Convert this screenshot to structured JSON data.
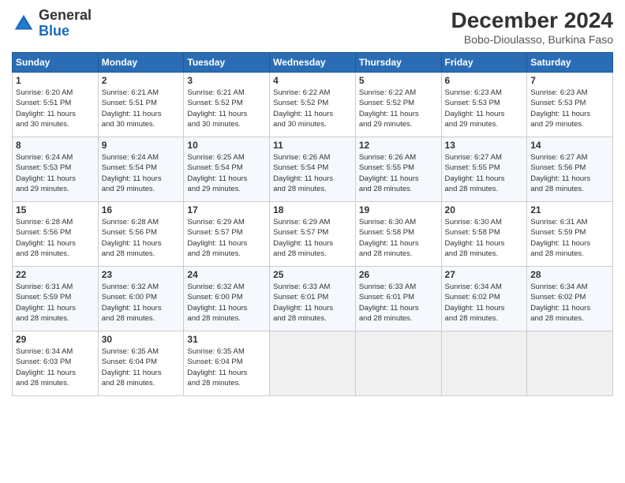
{
  "logo": {
    "line1": "General",
    "line2": "Blue"
  },
  "title": "December 2024",
  "subtitle": "Bobo-Dioulasso, Burkina Faso",
  "days_of_week": [
    "Sunday",
    "Monday",
    "Tuesday",
    "Wednesday",
    "Thursday",
    "Friday",
    "Saturday"
  ],
  "weeks": [
    [
      {
        "day": 1,
        "info": "Sunrise: 6:20 AM\nSunset: 5:51 PM\nDaylight: 11 hours\nand 30 minutes."
      },
      {
        "day": 2,
        "info": "Sunrise: 6:21 AM\nSunset: 5:51 PM\nDaylight: 11 hours\nand 30 minutes."
      },
      {
        "day": 3,
        "info": "Sunrise: 6:21 AM\nSunset: 5:52 PM\nDaylight: 11 hours\nand 30 minutes."
      },
      {
        "day": 4,
        "info": "Sunrise: 6:22 AM\nSunset: 5:52 PM\nDaylight: 11 hours\nand 30 minutes."
      },
      {
        "day": 5,
        "info": "Sunrise: 6:22 AM\nSunset: 5:52 PM\nDaylight: 11 hours\nand 29 minutes."
      },
      {
        "day": 6,
        "info": "Sunrise: 6:23 AM\nSunset: 5:53 PM\nDaylight: 11 hours\nand 29 minutes."
      },
      {
        "day": 7,
        "info": "Sunrise: 6:23 AM\nSunset: 5:53 PM\nDaylight: 11 hours\nand 29 minutes."
      }
    ],
    [
      {
        "day": 8,
        "info": "Sunrise: 6:24 AM\nSunset: 5:53 PM\nDaylight: 11 hours\nand 29 minutes."
      },
      {
        "day": 9,
        "info": "Sunrise: 6:24 AM\nSunset: 5:54 PM\nDaylight: 11 hours\nand 29 minutes."
      },
      {
        "day": 10,
        "info": "Sunrise: 6:25 AM\nSunset: 5:54 PM\nDaylight: 11 hours\nand 29 minutes."
      },
      {
        "day": 11,
        "info": "Sunrise: 6:26 AM\nSunset: 5:54 PM\nDaylight: 11 hours\nand 28 minutes."
      },
      {
        "day": 12,
        "info": "Sunrise: 6:26 AM\nSunset: 5:55 PM\nDaylight: 11 hours\nand 28 minutes."
      },
      {
        "day": 13,
        "info": "Sunrise: 6:27 AM\nSunset: 5:55 PM\nDaylight: 11 hours\nand 28 minutes."
      },
      {
        "day": 14,
        "info": "Sunrise: 6:27 AM\nSunset: 5:56 PM\nDaylight: 11 hours\nand 28 minutes."
      }
    ],
    [
      {
        "day": 15,
        "info": "Sunrise: 6:28 AM\nSunset: 5:56 PM\nDaylight: 11 hours\nand 28 minutes."
      },
      {
        "day": 16,
        "info": "Sunrise: 6:28 AM\nSunset: 5:56 PM\nDaylight: 11 hours\nand 28 minutes."
      },
      {
        "day": 17,
        "info": "Sunrise: 6:29 AM\nSunset: 5:57 PM\nDaylight: 11 hours\nand 28 minutes."
      },
      {
        "day": 18,
        "info": "Sunrise: 6:29 AM\nSunset: 5:57 PM\nDaylight: 11 hours\nand 28 minutes."
      },
      {
        "day": 19,
        "info": "Sunrise: 6:30 AM\nSunset: 5:58 PM\nDaylight: 11 hours\nand 28 minutes."
      },
      {
        "day": 20,
        "info": "Sunrise: 6:30 AM\nSunset: 5:58 PM\nDaylight: 11 hours\nand 28 minutes."
      },
      {
        "day": 21,
        "info": "Sunrise: 6:31 AM\nSunset: 5:59 PM\nDaylight: 11 hours\nand 28 minutes."
      }
    ],
    [
      {
        "day": 22,
        "info": "Sunrise: 6:31 AM\nSunset: 5:59 PM\nDaylight: 11 hours\nand 28 minutes."
      },
      {
        "day": 23,
        "info": "Sunrise: 6:32 AM\nSunset: 6:00 PM\nDaylight: 11 hours\nand 28 minutes."
      },
      {
        "day": 24,
        "info": "Sunrise: 6:32 AM\nSunset: 6:00 PM\nDaylight: 11 hours\nand 28 minutes."
      },
      {
        "day": 25,
        "info": "Sunrise: 6:33 AM\nSunset: 6:01 PM\nDaylight: 11 hours\nand 28 minutes."
      },
      {
        "day": 26,
        "info": "Sunrise: 6:33 AM\nSunset: 6:01 PM\nDaylight: 11 hours\nand 28 minutes."
      },
      {
        "day": 27,
        "info": "Sunrise: 6:34 AM\nSunset: 6:02 PM\nDaylight: 11 hours\nand 28 minutes."
      },
      {
        "day": 28,
        "info": "Sunrise: 6:34 AM\nSunset: 6:02 PM\nDaylight: 11 hours\nand 28 minutes."
      }
    ],
    [
      {
        "day": 29,
        "info": "Sunrise: 6:34 AM\nSunset: 6:03 PM\nDaylight: 11 hours\nand 28 minutes."
      },
      {
        "day": 30,
        "info": "Sunrise: 6:35 AM\nSunset: 6:04 PM\nDaylight: 11 hours\nand 28 minutes."
      },
      {
        "day": 31,
        "info": "Sunrise: 6:35 AM\nSunset: 6:04 PM\nDaylight: 11 hours\nand 28 minutes."
      },
      null,
      null,
      null,
      null
    ]
  ]
}
